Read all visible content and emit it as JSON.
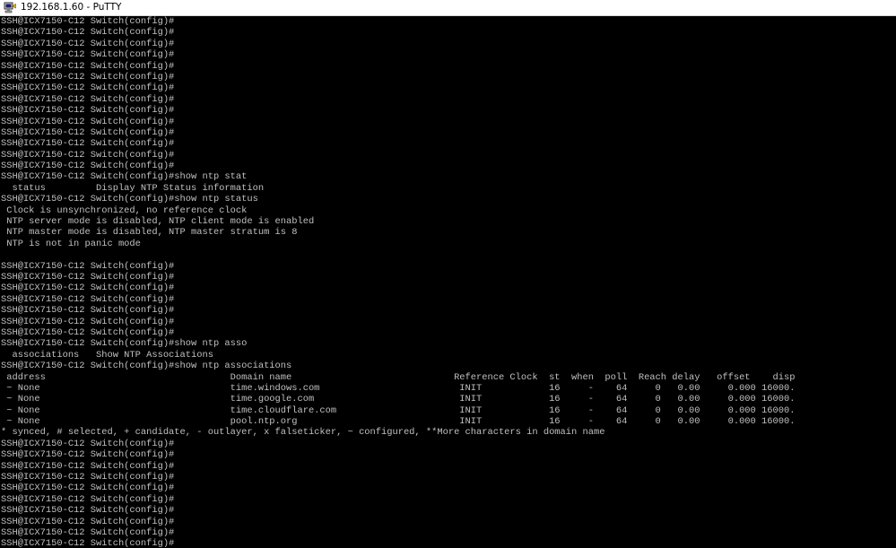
{
  "window": {
    "title": "192.168.1.60 - PuTTY",
    "icon": "putty-computer-icon"
  },
  "terminal": {
    "lines": [
      "SSH@ICX7150-C12 Switch(config)#",
      "SSH@ICX7150-C12 Switch(config)#",
      "SSH@ICX7150-C12 Switch(config)#",
      "SSH@ICX7150-C12 Switch(config)#",
      "SSH@ICX7150-C12 Switch(config)#",
      "SSH@ICX7150-C12 Switch(config)#",
      "SSH@ICX7150-C12 Switch(config)#",
      "SSH@ICX7150-C12 Switch(config)#",
      "SSH@ICX7150-C12 Switch(config)#",
      "SSH@ICX7150-C12 Switch(config)#",
      "SSH@ICX7150-C12 Switch(config)#",
      "SSH@ICX7150-C12 Switch(config)#",
      "SSH@ICX7150-C12 Switch(config)#",
      "SSH@ICX7150-C12 Switch(config)#",
      "SSH@ICX7150-C12 Switch(config)#show ntp stat",
      "  status         Display NTP Status information",
      "SSH@ICX7150-C12 Switch(config)#show ntp status",
      " Clock is unsynchronized, no reference clock",
      " NTP server mode is disabled, NTP client mode is enabled",
      " NTP master mode is disabled, NTP master stratum is 8",
      " NTP is not in panic mode",
      "",
      "SSH@ICX7150-C12 Switch(config)#",
      "SSH@ICX7150-C12 Switch(config)#",
      "SSH@ICX7150-C12 Switch(config)#",
      "SSH@ICX7150-C12 Switch(config)#",
      "SSH@ICX7150-C12 Switch(config)#",
      "SSH@ICX7150-C12 Switch(config)#",
      "SSH@ICX7150-C12 Switch(config)#",
      "SSH@ICX7150-C12 Switch(config)#show ntp asso",
      "  associations   Show NTP Associations",
      "SSH@ICX7150-C12 Switch(config)#show ntp associations",
      " address                                 Domain name                             Reference Clock  st  when  poll  Reach delay   offset    disp",
      " ~ None                                  time.windows.com                         INIT            16     -    64     0   0.00     0.000 16000.",
      " ~ None                                  time.google.com                          INIT            16     -    64     0   0.00     0.000 16000.",
      " ~ None                                  time.cloudflare.com                      INIT            16     -    64     0   0.00     0.000 16000.",
      " ~ None                                  pool.ntp.org                             INIT            16     -    64     0   0.00     0.000 16000.",
      "* synced, # selected, + candidate, - outlayer, x falseticker, ~ configured, **More characters in domain name",
      "SSH@ICX7150-C12 Switch(config)#",
      "SSH@ICX7150-C12 Switch(config)#",
      "SSH@ICX7150-C12 Switch(config)#",
      "SSH@ICX7150-C12 Switch(config)#",
      "SSH@ICX7150-C12 Switch(config)#",
      "SSH@ICX7150-C12 Switch(config)#",
      "SSH@ICX7150-C12 Switch(config)#",
      "SSH@ICX7150-C12 Switch(config)#",
      "SSH@ICX7150-C12 Switch(config)#",
      "SSH@ICX7150-C12 Switch(config)#",
      "SSH@ICX7150-C12 Switch(config)#"
    ],
    "cursor_color": "#00ff00",
    "text_color": "#c0c0c0",
    "background_color": "#000000"
  }
}
